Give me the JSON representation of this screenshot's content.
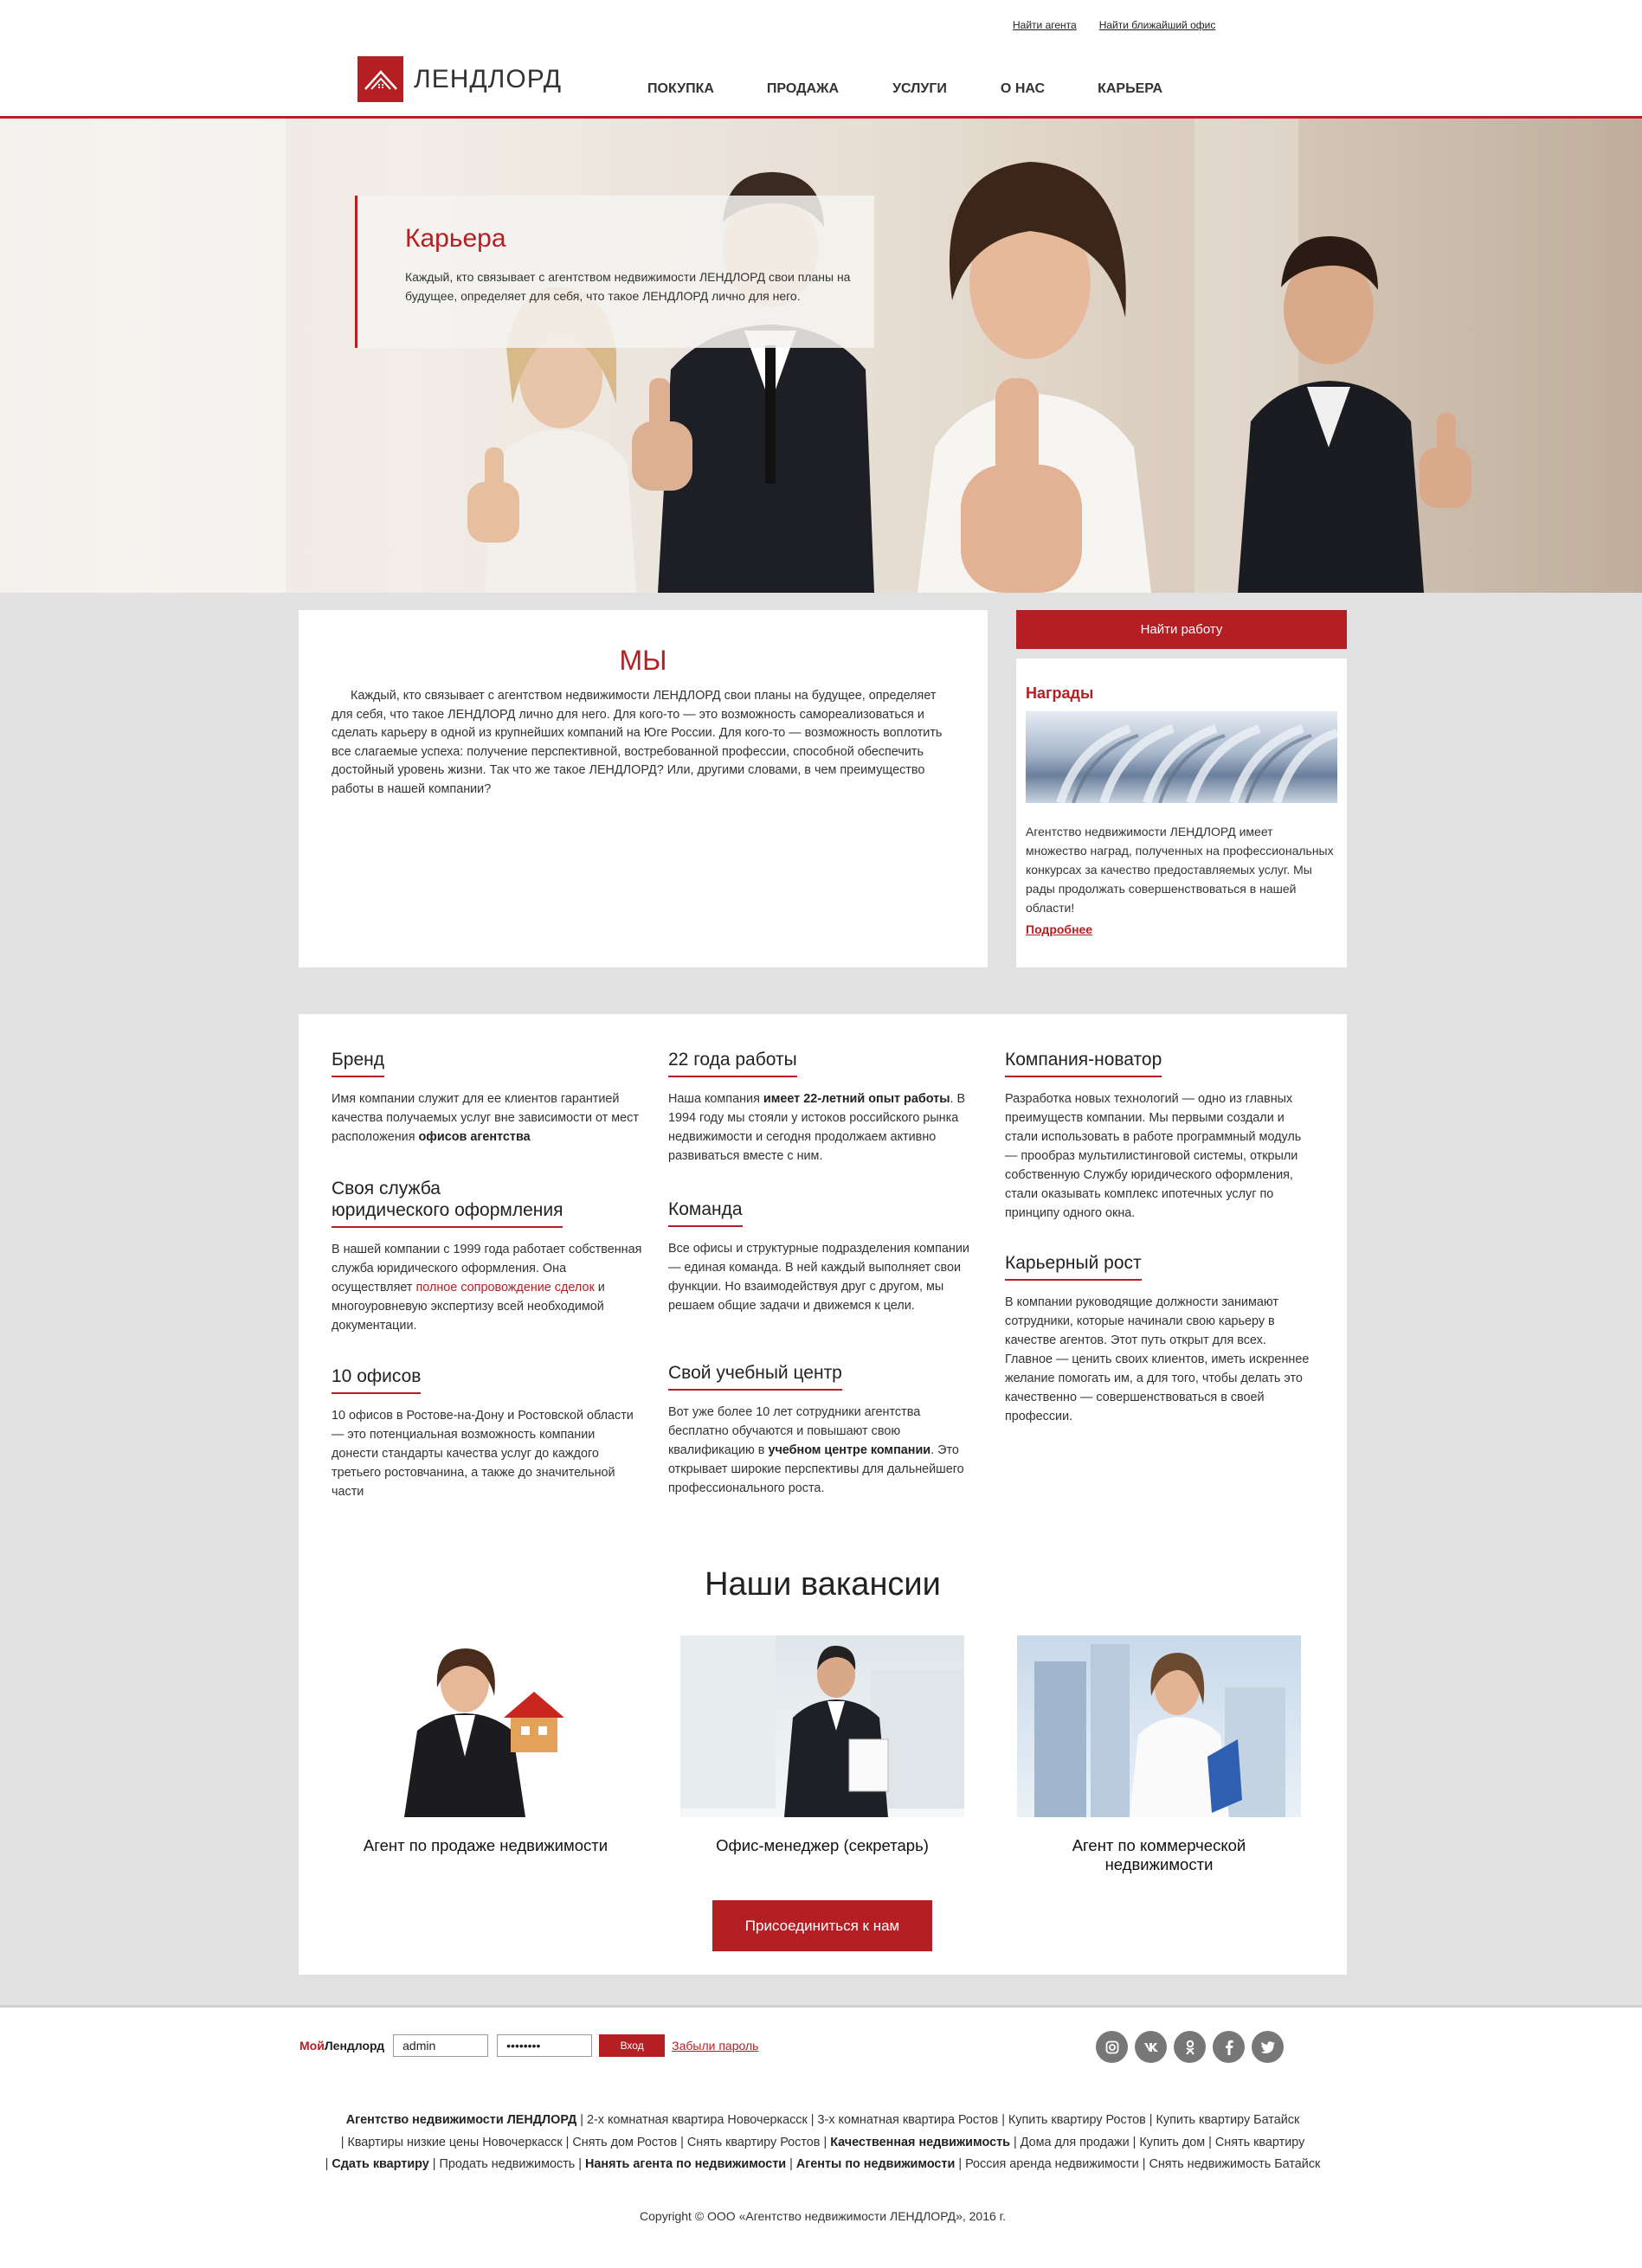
{
  "header": {
    "top_links": [
      "Найти агента",
      "Найти ближайший офис"
    ],
    "logo_text": "ЛЕНДЛОРД",
    "nav": [
      "ПОКУПКА",
      "ПРОДАЖА",
      "УСЛУГИ",
      "О НАС",
      "КАРЬЕРА"
    ]
  },
  "hero": {
    "title": "Карьера",
    "text": "Каждый, кто связывает с агентством недвижимости ЛЕНДЛОРД свои планы на будущее, определяет для себя, что такое ЛЕНДЛОРД лично для него."
  },
  "about": {
    "title": "МЫ",
    "text": "Каждый, кто связывает с агентством недвижимости ЛЕНДЛОРД свои планы на будущее, определяет для себя, что такое ЛЕНДЛОРД лично для него. Для кого-то — это возможность самореализоваться и сделать карьеру в одной из крупнейших компаний на Юге России. Для кого-то — возможность воплотить все слагаемые успеха: получение перспективной, востребованной профессии, способной обеспечить достойный уровень жизни. Так что же такое ЛЕНДЛОРД? Или, другими словами, в чем преимущество работы в нашей компании?"
  },
  "sidebar": {
    "find_job": "Найти работу",
    "awards_title": "Награды",
    "awards_text": "Агентство недвижимости ЛЕНДЛОРД имеет множество наград, полученных на профессиональных конкурсах за качество предоставляемых услуг. Мы рады продолжать совершенствоваться в нашей области!",
    "more": "Подробнее"
  },
  "features": {
    "brand": {
      "title": "Бренд",
      "t1": "Имя компании служит для ее клиентов гарантией качества получаемых услуг вне зависимости от мест расположения ",
      "b1": "офисов агентства"
    },
    "legal": {
      "title1": "Своя служба",
      "title2": "юридического оформления",
      "t1": "В нашей компании с 1999 года работает собственная служба юридического оформления. Она осуществляет ",
      "r1": "полное сопровождение сделок",
      "t2": " и многоуровневую экспертизу всей необходимой документации."
    },
    "offices": {
      "title": "10 офисов",
      "t1": "10 офисов в Ростове-на-Дону и Ростовской области — это потенциальная возможность компании донести стандарты качества услуг до каждого третьего ростовчанина, а также до значительной части"
    },
    "years": {
      "title": "22 года работы",
      "t1": "Наша компания ",
      "b1": "имеет 22-летний опыт работы",
      "t2": ". В 1994 году мы стояли у истоков российского рынка недвижимости и сегодня продолжаем активно развиваться вместе с ним."
    },
    "team": {
      "title": "Команда",
      "t1": "Все офисы и структурные подразделения компании — единая команда. В ней каждый выполняет свои функции. Но взаимодействуя друг с другом, мы решаем общие задачи и движемся к цели."
    },
    "training": {
      "title": "Свой учебный центр",
      "t1": "Вот уже более 10 лет сотрудники агентства бесплатно обучаются и повышают свою квалификацию в ",
      "b1": "учебном центре компании",
      "t2": ". Это открывает широкие перспективы для дальнейшего профессионального роста."
    },
    "innovator": {
      "title": "Компания-новатор",
      "t1": "Разработка новых технологий — одно из главных преимуществ компании. Мы первыми создали и стали использовать в работе программный модуль — прообраз мультилистинговой системы, открыли собственную Службу юридического оформления, стали оказывать комплекс ипотечных услуг по принципу одного окна."
    },
    "career": {
      "title": "Карьерный рост",
      "t1": "В компании руководящие должности занимают сотрудники, которые начинали свою карьеру в качестве агентов. Этот путь открыт для всех. Главное — ценить своих клиентов, иметь искреннее желание помогать им, а для того, чтобы делать это качественно — совершенствоваться в своей профессии."
    }
  },
  "vacancies": {
    "title": "Наши вакансии",
    "items": [
      "Агент по продаже недвижимости",
      "Офис-менеджер (секретарь)",
      "Агент по коммерческой недвижимости"
    ],
    "join": "Присоединиться к нам"
  },
  "footer": {
    "brand_red": "Мой",
    "brand_rest": "Лендлорд",
    "login_value": "admin",
    "password_value": "••••••••",
    "login_button": "Вход",
    "forgot": "Забыли пароль",
    "socials": [
      "instagram-icon",
      "vk-icon",
      "odnoklassniki-icon",
      "facebook-icon",
      "twitter-icon"
    ],
    "links_line1": [
      {
        "t": "Агентство недвижимости ЛЕНДЛОРД",
        "b": true
      },
      {
        "t": " | 2-х комнатная квартира Новочеркасск | 3-х комнатная квартира Ростов | Купить квартиру Ростов | Купить квартиру Батайск",
        "b": false
      }
    ],
    "links_line2": [
      {
        "t": "| Квартиры низкие цены Новочеркасск | Снять дом Ростов | Снять квартиру Ростов | ",
        "b": false
      },
      {
        "t": "Качественная недвижимость",
        "b": true
      },
      {
        "t": " | Дома для продажи | Купить дом | Снять квартиру",
        "b": false
      }
    ],
    "links_line3": [
      {
        "t": "| ",
        "b": false
      },
      {
        "t": "Сдать квартиру",
        "b": true
      },
      {
        "t": " | Продать недвижимость | ",
        "b": false
      },
      {
        "t": "Нанять агента по недвижимости",
        "b": true
      },
      {
        "t": " | ",
        "b": false
      },
      {
        "t": "Агенты по недвижимости",
        "b": true
      },
      {
        "t": " | Россия аренда недвижимости | Снять недвижимость Батайск",
        "b": false
      }
    ],
    "copyright": "Copyright © ООО «Агентство недвижимости ЛЕНДЛОРД», 2016 г."
  },
  "colors": {
    "accent": "#b51f24",
    "background_gray": "#e1e1e1"
  }
}
